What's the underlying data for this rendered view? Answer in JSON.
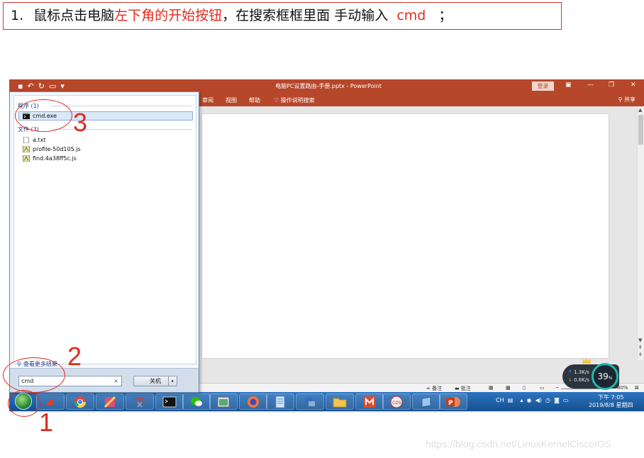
{
  "instruction": {
    "number": "1.",
    "text_before": "鼠标点击电脑",
    "text_red": "左下角的开始按钮",
    "text_after": "，在搜索框框里面 手动输入",
    "command": "cmd",
    "semicolon": "；"
  },
  "powerpoint": {
    "document_title": "电脑PC设置路由-手册.pptx  -  PowerPoint",
    "login_button": "登录",
    "ribbon_tabs": [
      "审阅",
      "视图",
      "帮助"
    ],
    "tell_me": "操作说明搜索",
    "share": "共享",
    "status": {
      "notes": "备注",
      "comments": "批注",
      "zoom": "80%"
    }
  },
  "start_menu": {
    "programs_heading": "程序 (1)",
    "programs": [
      {
        "label": "cmd.exe",
        "icon": "console-icon"
      }
    ],
    "files_heading": "文件 (3)",
    "files": [
      {
        "label": "a.txt",
        "icon": "text-file-icon"
      },
      {
        "label": "profile-50d105.js",
        "icon": "script-file-icon"
      },
      {
        "label": "find.4a38ff5c.js",
        "icon": "script-file-icon"
      }
    ],
    "see_more": "查看更多结果",
    "search_value": "cmd",
    "clear": "×",
    "shutdown_label": "关机",
    "shutdown_arrow": "▸"
  },
  "annotations": {
    "step1": "1",
    "step2": "2",
    "step3": "3"
  },
  "taskbar": {
    "apps": [
      "start",
      "360-browser",
      "chrome",
      "xmind",
      "snipping-tool",
      "console",
      "wechat",
      "app-window",
      "firefox",
      "notepad",
      "network-tool",
      "file-explorer",
      "mail",
      "cds",
      "virtualbox",
      "powerpoint"
    ],
    "tray_lang": "CH",
    "time": "下午 7:05",
    "date": "2019/8/8 星期四"
  },
  "network_widget": {
    "upload": "1.3K/s",
    "download": "0.6K/s",
    "percent": "39",
    "percent_unit": "%"
  },
  "watermark": "https://blog.csdn.net/LinuxKernelCiscoIOS"
}
